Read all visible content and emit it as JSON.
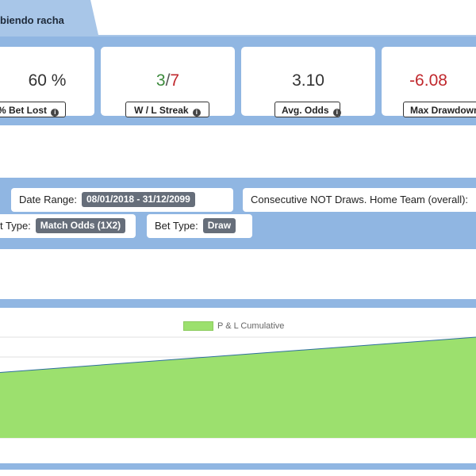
{
  "tab": {
    "label": "biendo racha"
  },
  "stats": {
    "bet_lost": {
      "value": "60 %",
      "label": "% Bet Lost"
    },
    "wl_streak": {
      "wins": "3",
      "separator": "/",
      "losses": "7",
      "label": "W / L Streak"
    },
    "avg_odds": {
      "value": "3.10",
      "label": "Avg. Odds"
    },
    "max_drawdown": {
      "value": "-6.08",
      "label": "Max Drawdown"
    }
  },
  "filters": {
    "date_range": {
      "label": "Date Range:",
      "value": "08/01/2018 - 31/12/2099"
    },
    "strategy": {
      "label": "Consecutive NOT Draws. Home Team (overall):"
    },
    "market_type": {
      "label": "t Type:",
      "value": "Match Odds (1X2)"
    },
    "bet_type": {
      "label": "Bet Type:",
      "value": "Draw"
    }
  },
  "icons": {
    "info": "info-circle-icon"
  },
  "colors": {
    "band": "#90b6e2",
    "win": "#3c8a3c",
    "loss": "#c0282d",
    "area_fill": "#9ce06e",
    "area_line": "#2f6f9f"
  },
  "chart_data": {
    "type": "area",
    "series": [
      {
        "name": "P & L Cumulative",
        "values": [
          0.65,
          1.0
        ]
      }
    ],
    "grid": true,
    "legend": "top-center"
  }
}
